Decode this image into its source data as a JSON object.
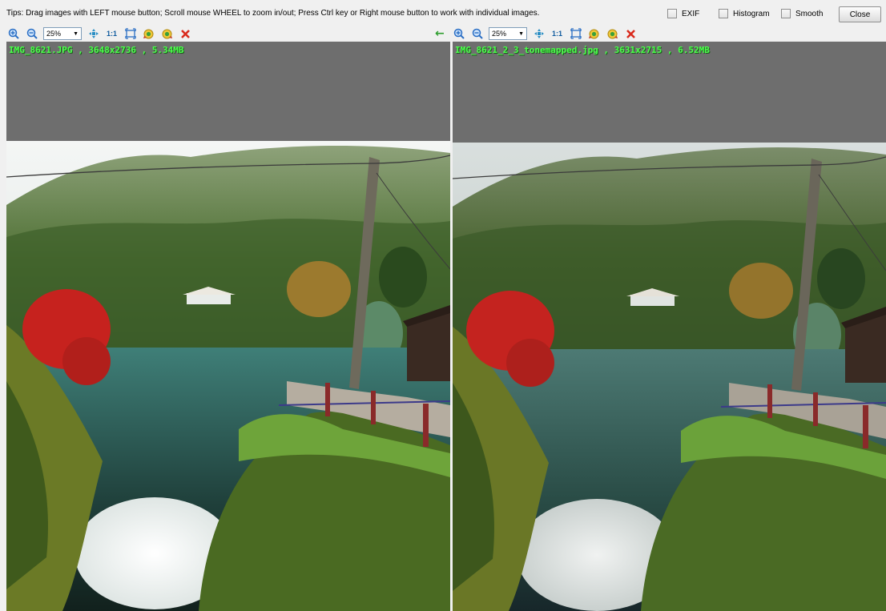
{
  "tips": "Tips: Drag images with LEFT mouse button; Scroll mouse WHEEL to zoom in/out; Press Ctrl key or Right mouse button to work with individual images.",
  "options": {
    "exif_label": "EXIF",
    "histogram_label": "Histogram",
    "smooth_label": "Smooth",
    "close_label": "Close"
  },
  "left_viewer": {
    "zoom": "25%",
    "one_to_one": "1:1",
    "caption": "IMG_8621.JPG , 3648x2736 , 5.34MB"
  },
  "right_viewer": {
    "zoom": "25%",
    "one_to_one": "1:1",
    "caption": "IMG_8621_2_3_tonemapped.jpg , 3631x2715 , 6.52MB"
  },
  "icons": {
    "zoom_in": "zoom-in-icon",
    "zoom_out": "zoom-out-icon",
    "fit": "fit-to-window-icon",
    "fullscreen": "fullscreen-icon",
    "rotate_left": "rotate-left-icon",
    "rotate_right": "rotate-right-icon",
    "delete": "delete-icon",
    "sync": "sync-arrow-icon"
  },
  "colors": {
    "caption_green": "#4cff4c",
    "delete_red": "#d92a1c",
    "panel_gray": "#6e6e6e"
  }
}
